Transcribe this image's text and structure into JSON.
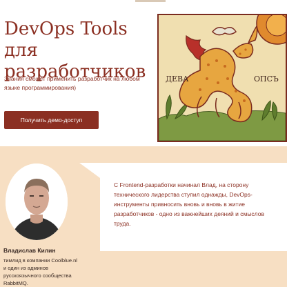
{
  "hero": {
    "title": "DevOps Tools для разработчиков",
    "subtitle": "Знания сможет применить разработчик на любом языке программирования)",
    "cta_label": "Получить демо-доступ",
    "illustration": {
      "label_left": "ДЕВА",
      "label_right": "ОПСЪ"
    }
  },
  "testimonial": {
    "quote": "С Frontend-разработки начинал Влад, на сторону технического лидерства ступил однажды, DevOps-инструменты привносить вновь и вновь в житие разработчиков - одно из важнейших деяний и смыслов труда.",
    "author_name": "Владислав Килин",
    "author_bio": "тимлид в компании Coolblue.nl и один из админов русскоязычного сообщества RabbitMQ."
  },
  "colors": {
    "brand": "#8b2f22",
    "testimonial_bg": "#f7dfc3",
    "illustration_bg": "#f0dfb0"
  }
}
